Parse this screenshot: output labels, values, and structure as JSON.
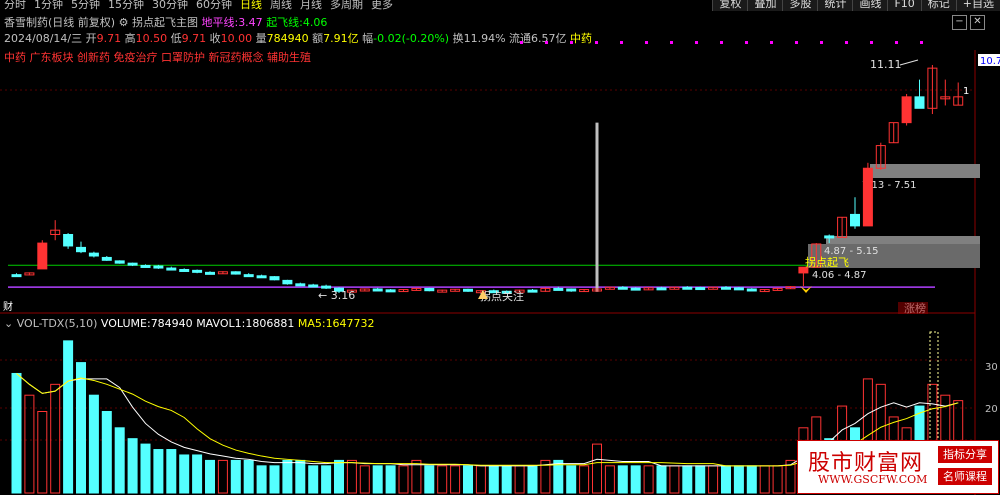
{
  "toolbar": {
    "periods": [
      "分时",
      "1分钟",
      "5分钟",
      "15分钟",
      "30分钟",
      "60分钟",
      "日线",
      "周线",
      "月线",
      "多周期",
      "更多"
    ],
    "active_period": "日线",
    "tools": [
      "复权",
      "叠加",
      "多股",
      "统计",
      "画线",
      "F10",
      "标记",
      "+自选"
    ]
  },
  "header": {
    "stock_name": "香雪制药",
    "mode": "(日线 前复权)",
    "indicator_name": "拐点起飞主图",
    "ground_label": "地平线:",
    "ground_value": "3.47",
    "takeoff_label": "起飞线:",
    "takeoff_value": "4.06"
  },
  "quote": {
    "date": "2024/08/14/三",
    "open_label": "开",
    "open": "9.71",
    "high_label": "高",
    "high": "10.50",
    "low_label": "低",
    "low": "9.71",
    "close_label": "收",
    "close": "10.00",
    "vol_label": "量",
    "volume": "784940",
    "amount_label": "额",
    "amount": "7.91亿",
    "change_label": "幅",
    "change": "-0.02(-0.20%)",
    "turnover_label": "换",
    "turnover": "11.94%",
    "float_label": "流通",
    "float": "6.57亿",
    "sector": "中药"
  },
  "concepts": "中药 广东板块 创新药 免疫治疗 口罩防护 新冠药概念 辅助生殖",
  "annotations": {
    "high_mark": "11.11",
    "low_mark": "3.16",
    "zone1": "7.13 - 7.51",
    "zone2": "4.87 - 5.15",
    "zone3": "4.06 - 4.87",
    "guaidian": "拐点起飞",
    "guanzhu": "拐点关注",
    "zhangbang": "涨榜",
    "cai": "财",
    "price_tag": "10.7",
    "axis_label": "1"
  },
  "volume_panel": {
    "indicator": "VOL-TDX(5,10)",
    "volume_label": "VOLUME:",
    "volume": "784940",
    "mavol1_label": "MAVOL1:",
    "mavol1": "1806881",
    "ma5_label": "MA5:",
    "ma5": "1647732",
    "axis_labels": [
      "30",
      "20"
    ]
  },
  "watermark": {
    "main": "股市财富网",
    "url": "WWW.GSCFW.COM",
    "tag1": "指标分享",
    "tag2": "名师课程"
  },
  "colors": {
    "up": "#ff3333",
    "down": "#54ffff",
    "ground_line": "#b040ff",
    "takeoff_line": "#00cc00",
    "volume_ma": "#ffffff",
    "volume_ma2": "#ffff00"
  },
  "chart_data": {
    "type": "candlestick",
    "note_days": "daily bars, oldest to newest",
    "candles": [
      {
        "o": 3.8,
        "h": 3.85,
        "l": 3.75,
        "c": 3.78
      },
      {
        "o": 3.8,
        "h": 3.88,
        "l": 3.78,
        "c": 3.86
      },
      {
        "o": 4.0,
        "h": 5.0,
        "l": 4.0,
        "c": 4.9
      },
      {
        "o": 5.2,
        "h": 5.7,
        "l": 5.0,
        "c": 5.35
      },
      {
        "o": 5.2,
        "h": 5.25,
        "l": 4.7,
        "c": 4.8
      },
      {
        "o": 4.75,
        "h": 4.95,
        "l": 4.55,
        "c": 4.6
      },
      {
        "o": 4.55,
        "h": 4.6,
        "l": 4.4,
        "c": 4.45
      },
      {
        "o": 4.4,
        "h": 4.45,
        "l": 4.28,
        "c": 4.3
      },
      {
        "o": 4.28,
        "h": 4.3,
        "l": 4.18,
        "c": 4.2
      },
      {
        "o": 4.2,
        "h": 4.22,
        "l": 4.1,
        "c": 4.15
      },
      {
        "o": 4.12,
        "h": 4.16,
        "l": 4.05,
        "c": 4.1
      },
      {
        "o": 4.1,
        "h": 4.14,
        "l": 4.0,
        "c": 4.03
      },
      {
        "o": 4.03,
        "h": 4.08,
        "l": 3.95,
        "c": 3.98
      },
      {
        "o": 3.98,
        "h": 4.02,
        "l": 3.9,
        "c": 3.95
      },
      {
        "o": 3.95,
        "h": 3.98,
        "l": 3.85,
        "c": 3.88
      },
      {
        "o": 3.88,
        "h": 3.92,
        "l": 3.82,
        "c": 3.85
      },
      {
        "o": 3.86,
        "h": 3.92,
        "l": 3.84,
        "c": 3.9
      },
      {
        "o": 3.9,
        "h": 3.92,
        "l": 3.8,
        "c": 3.82
      },
      {
        "o": 3.8,
        "h": 3.85,
        "l": 3.72,
        "c": 3.76
      },
      {
        "o": 3.76,
        "h": 3.8,
        "l": 3.7,
        "c": 3.73
      },
      {
        "o": 3.73,
        "h": 3.75,
        "l": 3.6,
        "c": 3.62
      },
      {
        "o": 3.6,
        "h": 3.62,
        "l": 3.45,
        "c": 3.48
      },
      {
        "o": 3.48,
        "h": 3.52,
        "l": 3.4,
        "c": 3.44
      },
      {
        "o": 3.44,
        "h": 3.48,
        "l": 3.38,
        "c": 3.4
      },
      {
        "o": 3.4,
        "h": 3.45,
        "l": 3.3,
        "c": 3.33
      },
      {
        "o": 3.33,
        "h": 3.36,
        "l": 3.16,
        "c": 3.22
      },
      {
        "o": 3.22,
        "h": 3.28,
        "l": 3.18,
        "c": 3.26
      },
      {
        "o": 3.26,
        "h": 3.32,
        "l": 3.22,
        "c": 3.3
      },
      {
        "o": 3.3,
        "h": 3.34,
        "l": 3.24,
        "c": 3.27
      },
      {
        "o": 3.27,
        "h": 3.3,
        "l": 3.2,
        "c": 3.25
      },
      {
        "o": 3.25,
        "h": 3.3,
        "l": 3.22,
        "c": 3.28
      },
      {
        "o": 3.28,
        "h": 3.34,
        "l": 3.25,
        "c": 3.32
      },
      {
        "o": 3.32,
        "h": 3.34,
        "l": 3.22,
        "c": 3.24
      },
      {
        "o": 3.24,
        "h": 3.28,
        "l": 3.2,
        "c": 3.26
      },
      {
        "o": 3.26,
        "h": 3.3,
        "l": 3.22,
        "c": 3.29
      },
      {
        "o": 3.29,
        "h": 3.31,
        "l": 3.2,
        "c": 3.22
      },
      {
        "o": 3.22,
        "h": 3.26,
        "l": 3.18,
        "c": 3.24
      },
      {
        "o": 3.24,
        "h": 3.28,
        "l": 3.2,
        "c": 3.22
      },
      {
        "o": 3.22,
        "h": 3.25,
        "l": 3.16,
        "c": 3.19
      },
      {
        "o": 3.19,
        "h": 3.28,
        "l": 3.18,
        "c": 3.26
      },
      {
        "o": 3.26,
        "h": 3.3,
        "l": 3.2,
        "c": 3.22
      },
      {
        "o": 3.22,
        "h": 3.35,
        "l": 3.2,
        "c": 3.32
      },
      {
        "o": 3.32,
        "h": 3.38,
        "l": 3.28,
        "c": 3.3
      },
      {
        "o": 3.3,
        "h": 3.32,
        "l": 3.2,
        "c": 3.23
      },
      {
        "o": 3.23,
        "h": 3.3,
        "l": 3.21,
        "c": 3.28
      },
      {
        "o": 3.28,
        "h": 9.1,
        "l": 3.2,
        "c": 3.3
      },
      {
        "o": 3.3,
        "h": 3.38,
        "l": 3.28,
        "c": 3.36
      },
      {
        "o": 3.36,
        "h": 3.4,
        "l": 3.3,
        "c": 3.33
      },
      {
        "o": 3.33,
        "h": 3.36,
        "l": 3.27,
        "c": 3.3
      },
      {
        "o": 3.3,
        "h": 3.36,
        "l": 3.28,
        "c": 3.34
      },
      {
        "o": 3.34,
        "h": 3.38,
        "l": 3.3,
        "c": 3.32
      },
      {
        "o": 3.32,
        "h": 3.38,
        "l": 3.3,
        "c": 3.36
      },
      {
        "o": 3.36,
        "h": 3.4,
        "l": 3.32,
        "c": 3.35
      },
      {
        "o": 3.35,
        "h": 3.38,
        "l": 3.3,
        "c": 3.33
      },
      {
        "o": 3.33,
        "h": 3.38,
        "l": 3.31,
        "c": 3.36
      },
      {
        "o": 3.36,
        "h": 3.4,
        "l": 3.32,
        "c": 3.34
      },
      {
        "o": 3.34,
        "h": 3.37,
        "l": 3.27,
        "c": 3.3
      },
      {
        "o": 3.3,
        "h": 3.33,
        "l": 3.22,
        "c": 3.25
      },
      {
        "o": 3.25,
        "h": 3.3,
        "l": 3.22,
        "c": 3.28
      },
      {
        "o": 3.28,
        "h": 3.34,
        "l": 3.26,
        "c": 3.32
      },
      {
        "o": 3.32,
        "h": 3.4,
        "l": 3.3,
        "c": 3.38
      },
      {
        "o": 3.86,
        "h": 4.06,
        "l": 3.4,
        "c": 4.06
      },
      {
        "o": 4.06,
        "h": 4.9,
        "l": 4.06,
        "c": 4.87
      },
      {
        "o": 5.15,
        "h": 5.2,
        "l": 4.9,
        "c": 5.1
      },
      {
        "o": 5.1,
        "h": 5.8,
        "l": 5.1,
        "c": 5.8
      },
      {
        "o": 5.9,
        "h": 6.5,
        "l": 5.4,
        "c": 5.5
      },
      {
        "o": 5.5,
        "h": 7.7,
        "l": 5.5,
        "c": 7.51
      },
      {
        "o": 7.51,
        "h": 8.4,
        "l": 7.45,
        "c": 8.3
      },
      {
        "o": 8.4,
        "h": 9.1,
        "l": 8.4,
        "c": 9.1
      },
      {
        "o": 9.1,
        "h": 10.1,
        "l": 9.0,
        "c": 10.0
      },
      {
        "o": 10.0,
        "h": 10.6,
        "l": 9.6,
        "c": 9.6
      },
      {
        "o": 9.6,
        "h": 11.11,
        "l": 9.4,
        "c": 11.0
      },
      {
        "o": 10.0,
        "h": 10.6,
        "l": 9.7,
        "c": 10.0
      },
      {
        "o": 9.71,
        "h": 10.5,
        "l": 9.71,
        "c": 10.0
      }
    ],
    "volume": [
      22,
      18,
      15,
      20,
      28,
      24,
      18,
      15,
      12,
      10,
      9,
      8,
      8,
      7,
      7,
      6,
      6,
      6,
      6,
      5,
      5,
      6,
      6,
      5,
      5,
      6,
      6,
      5,
      5,
      5,
      5,
      6,
      5,
      5,
      5,
      5,
      5,
      5,
      5,
      5,
      5,
      6,
      6,
      5,
      5,
      9,
      5,
      5,
      5,
      5,
      5,
      5,
      5,
      5,
      5,
      5,
      5,
      5,
      5,
      5,
      6,
      12,
      14,
      10,
      16,
      12,
      21,
      20,
      14,
      12,
      16,
      20,
      18,
      17
    ],
    "ground_line": 3.47,
    "takeoff_line": 4.06
  }
}
